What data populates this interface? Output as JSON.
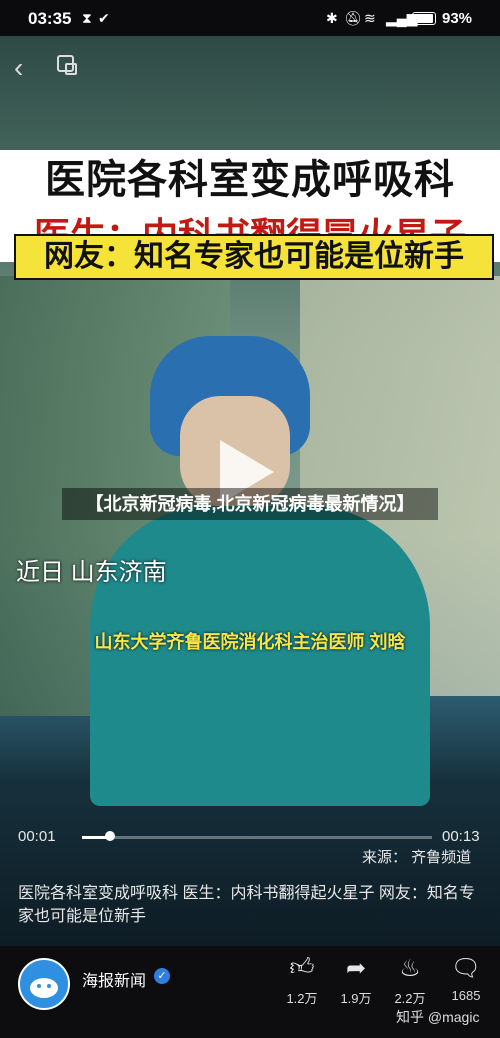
{
  "status_bar": {
    "time": "03:35",
    "battery": "93%",
    "icons": [
      "hourglass-icon",
      "app-icon",
      "bluetooth-icon",
      "mute-icon",
      "wifi-icon",
      "signal-icon",
      "battery-icon"
    ]
  },
  "video": {
    "caption_line1": "医院各科室变成呼吸科",
    "caption_line2": "医生：内科书翻得冒火星子",
    "caption_line3": "网友：知名专家也可能是位新手",
    "location": "近日 山东济南",
    "doctor_caption": "山东大学齐鲁医院消化科主治医师 刘晗",
    "article_title": "【北京新冠病毒,北京新冠病毒最新情况】",
    "current_time": "00:01",
    "duration": "00:13",
    "progress": 0.08,
    "source": "来源： 齐鲁频道"
  },
  "description": "医院各科室变成呼吸科 医生：内科书翻得起火星子 网友：知名专家也可能是位新手",
  "author": {
    "name": "海报新闻",
    "verified": true
  },
  "actions": [
    {
      "icon": "thumbs-up-icon",
      "count": "1.2万"
    },
    {
      "icon": "share-icon",
      "count": "1.9万"
    },
    {
      "icon": "flame-icon",
      "count": "2.2万"
    },
    {
      "icon": "comment-icon",
      "count": "1685"
    }
  ],
  "watermark": "知乎 @magic"
}
